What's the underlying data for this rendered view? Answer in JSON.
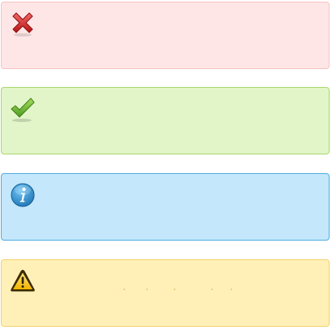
{
  "notifications": [
    {
      "type": "error",
      "icon": "close-x-icon",
      "message": ""
    },
    {
      "type": "success",
      "icon": "checkmark-icon",
      "message": ""
    },
    {
      "type": "info",
      "icon": "info-icon",
      "message": ""
    },
    {
      "type": "warning",
      "icon": "warning-icon",
      "message": ""
    }
  ],
  "colors": {
    "error_bg": "#ffe6e6",
    "error_border": "#f6c3c3",
    "success_bg": "#e2f5c9",
    "success_border": "#a9d86e",
    "info_bg": "#c4e7fb",
    "info_border": "#52aee0",
    "warning_bg": "#fff0b8",
    "warning_border": "#f2d26c"
  }
}
